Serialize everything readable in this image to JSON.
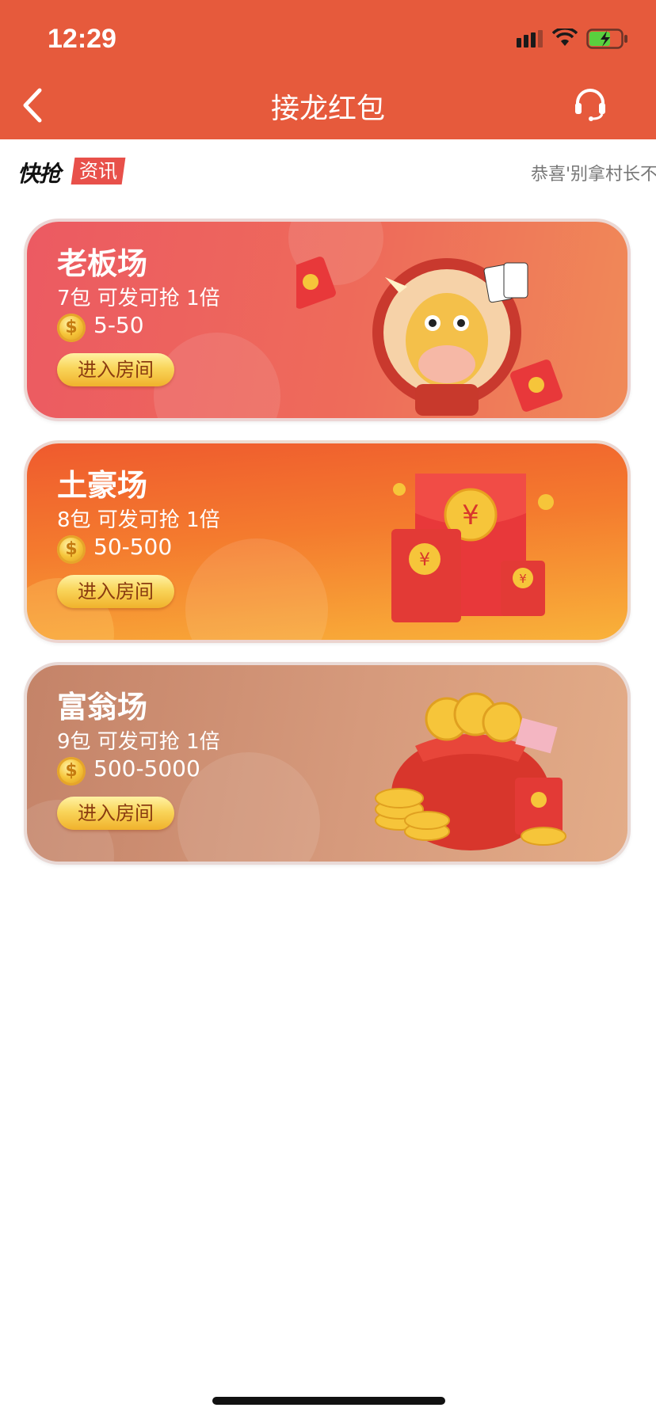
{
  "status_bar": {
    "time": "12:29"
  },
  "header": {
    "title": "接龙红包"
  },
  "ticker": {
    "logo": "快抢",
    "tag": "资讯",
    "text": "恭喜'别拿村长不"
  },
  "rooms": [
    {
      "title": "老板场",
      "desc": "7包 可发可抢 1倍",
      "range": "5-50",
      "button": "进入房间"
    },
    {
      "title": "土豪场",
      "desc": "8包 可发可抢 1倍",
      "range": "50-500",
      "button": "进入房间"
    },
    {
      "title": "富翁场",
      "desc": "9包 可发可抢 1倍",
      "range": "500-5000",
      "button": "进入房间"
    }
  ],
  "colors": {
    "header": "#e65a3c",
    "card1": "#ec5a62",
    "card2": "#f47b2e",
    "card3": "#d69a7c",
    "button": "#f9d55a"
  },
  "icons": {
    "back": "chevron-left-icon",
    "service": "headset-icon",
    "coin": "coin-icon"
  }
}
